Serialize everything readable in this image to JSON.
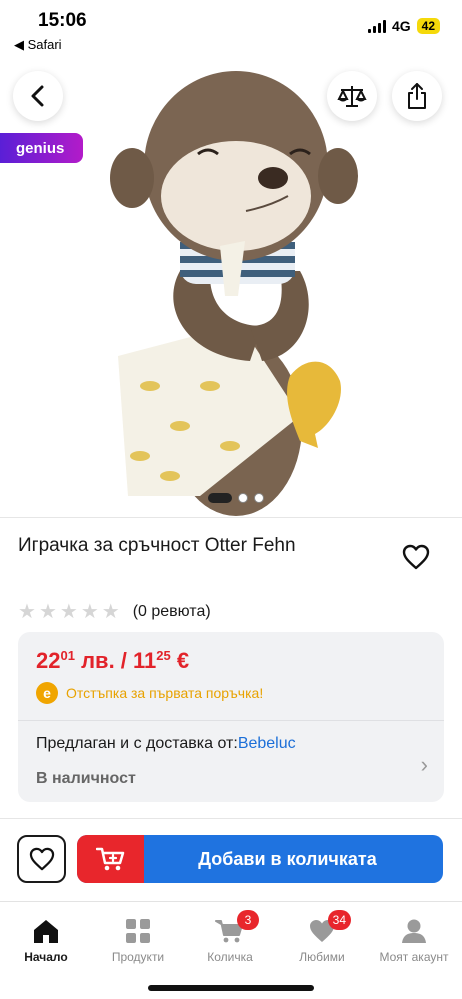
{
  "status_bar": {
    "time": "15:06",
    "back_app": "◀ Safari",
    "network": "4G",
    "battery": "42"
  },
  "product_image": {
    "promo_badge": "genius",
    "carousel_current": 1,
    "carousel_total": 3
  },
  "product": {
    "title": "Играчка за сръчност Otter Fehn",
    "rating_stars": 0,
    "reviews": "(0 ревюта)"
  },
  "offer": {
    "price_bgn_main": "22",
    "price_bgn_cents": "01",
    "price_bgn_unit": " лв. / ",
    "price_eur_main": "11",
    "price_eur_cents": "25",
    "price_eur_unit": " €",
    "promo_text": "Отстъпка за първата поръчка!",
    "promo_icon": "e",
    "seller_label": "Предлаган и с доставка от:",
    "seller_name": "Bebeluc",
    "stock": "В наличност"
  },
  "actions": {
    "add_to_cart": "Добави в количката"
  },
  "tab_bar": {
    "items": [
      {
        "label": "Начало",
        "icon": "home-icon",
        "active": true
      },
      {
        "label": "Продукти",
        "icon": "grid-icon"
      },
      {
        "label": "Количка",
        "icon": "cart-icon",
        "badge": "3"
      },
      {
        "label": "Любими",
        "icon": "heart-icon",
        "badge": "34"
      },
      {
        "label": "Моят акаунт",
        "icon": "user-icon"
      }
    ]
  },
  "colors": {
    "accent_red": "#e2232a",
    "accent_blue": "#1f73e0",
    "promo_orange": "#e8a200",
    "link_blue": "#1c6fd8"
  }
}
